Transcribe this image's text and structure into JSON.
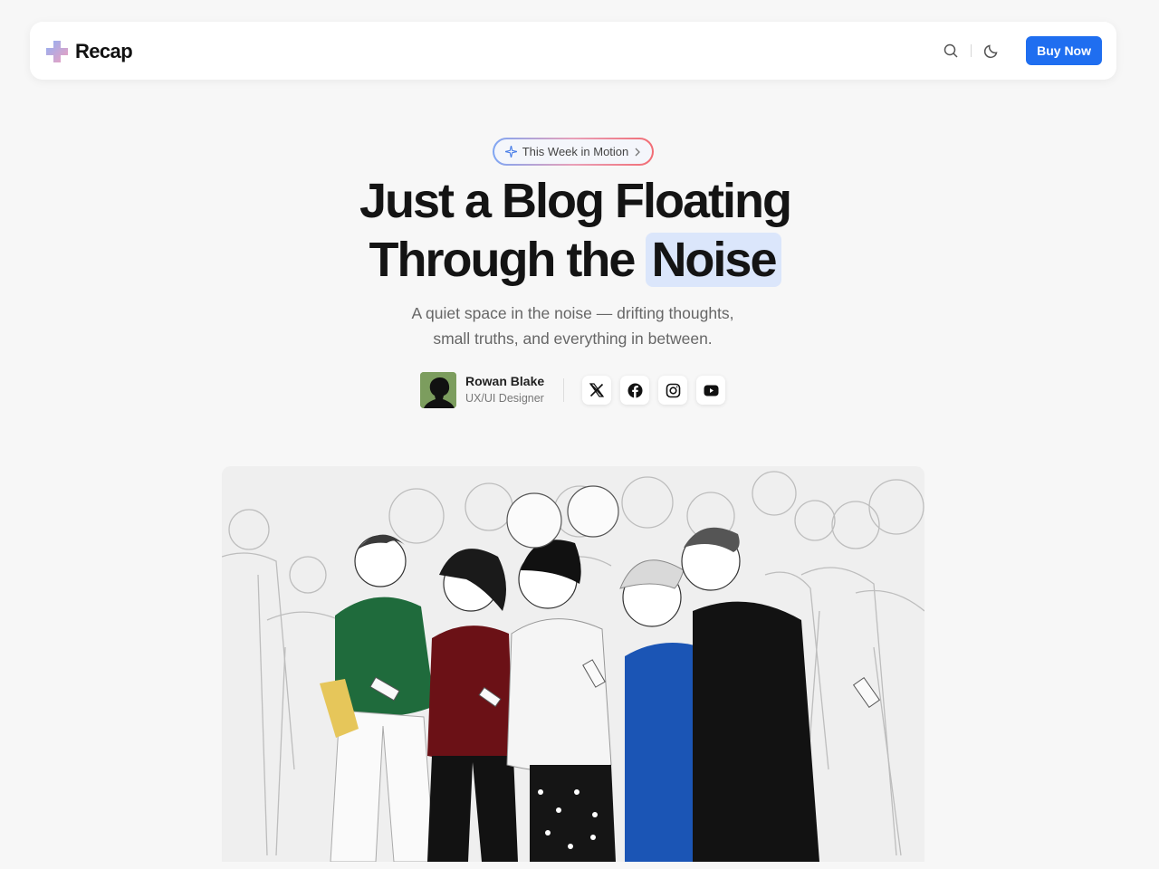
{
  "nav": {
    "brand": "Recap",
    "icons": [
      "search-icon",
      "moon-icon"
    ],
    "buy_label": "Buy Now",
    "accent": "#1f6ef0"
  },
  "announcement": {
    "label": "This Week in Motion",
    "icon": "sparkle-icon"
  },
  "hero": {
    "title_line1": "Just a Blog Floating",
    "title_line2_prefix": "Through the",
    "title_highlight": "Noise",
    "subtitle_line1": "A quiet space in the noise — drifting thoughts,",
    "subtitle_line2": "small truths, and everything in between."
  },
  "author": {
    "name": "Rowan Blake",
    "role": "UX/UI Designer"
  },
  "socials": [
    "x-icon",
    "facebook-icon",
    "instagram-icon",
    "youtube-icon"
  ]
}
